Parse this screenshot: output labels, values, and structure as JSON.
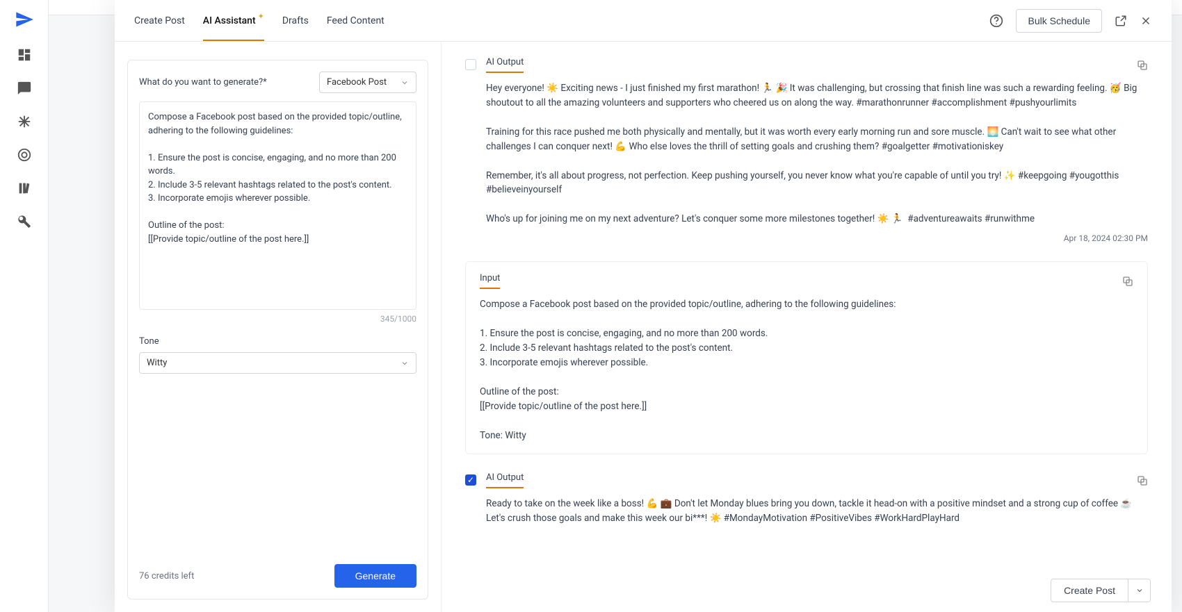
{
  "sidebar": {
    "icons": [
      "paper-plane",
      "dashboard",
      "chat",
      "network",
      "target",
      "library",
      "wrench"
    ]
  },
  "tabs": {
    "create_post": "Create Post",
    "ai_assistant": "AI Assistant",
    "drafts": "Drafts",
    "feed_content": "Feed Content"
  },
  "header": {
    "bulk_schedule": "Bulk Schedule"
  },
  "prompt": {
    "question_label": "What do you want to generate?*",
    "post_type": "Facebook Post",
    "textarea_value": "Compose a Facebook post based on the provided topic/outline, adhering to the following guidelines:\n\n1. Ensure the post is concise, engaging, and no more than 200 words.\n2. Include 3-5 relevant hashtags related to the post's content.\n3. Incorporate emojis wherever possible.\n\nOutline of the post:\n[[Provide topic/outline of the post here.]]",
    "counter": "345/1000",
    "tone_label": "Tone",
    "tone_value": "Witty",
    "credits": "76 credits left",
    "generate": "Generate"
  },
  "output1": {
    "title": "AI Output",
    "body": "Hey everyone! ☀️ Exciting news - I just finished my first marathon! 🏃 🎉 It was challenging, but crossing that finish line was such a rewarding feeling. 🥳 Big shoutout to all the amazing volunteers and supporters who cheered us on along the way. #marathonrunner #accomplishment #pushyourlimits\n\nTraining for this race pushed me both physically and mentally, but it was worth every early morning run and sore muscle. 🌅 Can't wait to see what other challenges I can conquer next! 💪 Who else loves the thrill of setting goals and crushing them? #goalgetter #motivationiskey\n\nRemember, it's all about progress, not perfection. Keep pushing yourself, you never know what you're capable of until you try! ✨ #keepgoing #yougotthis #believeinyourself\n\nWho's up for joining me on my next adventure? Let's conquer some more milestones together! ☀️ 🏃  #adventureawaits #runwithme",
    "timestamp": "Apr 18, 2024 02:30 PM"
  },
  "input_section": {
    "title": "Input",
    "body": "Compose a Facebook post based on the provided topic/outline, adhering to the following guidelines:\n\n1. Ensure the post is concise, engaging, and no more than 200 words.\n2. Include 3-5 relevant hashtags related to the post's content.\n3. Incorporate emojis wherever possible.\n\nOutline of the post:\n[[Provide topic/outline of the post here.]]\n\nTone: Witty"
  },
  "output2": {
    "title": "AI Output",
    "body": "Ready to take on the week like a boss! 💪 💼 Don't let Monday blues bring you down, tackle it head-on with a positive mindset and a strong cup of coffee ☕ Let's crush those goals and make this week our bi***! ☀️ #MondayMotivation #PositiveVibes #WorkHardPlayHard"
  },
  "footer": {
    "create_post": "Create Post"
  }
}
